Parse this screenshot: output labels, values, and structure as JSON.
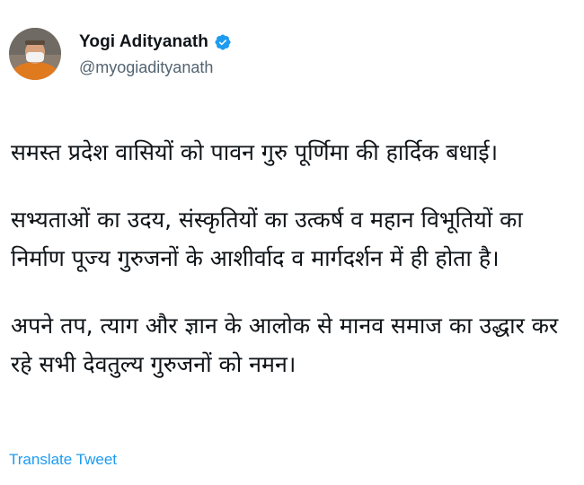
{
  "author": {
    "name": "Yogi Adityanath",
    "handle": "@myogiadityanath",
    "verified_icon": "verified-badge-icon",
    "avatar_icon": "profile-avatar"
  },
  "tweet": {
    "paragraphs": [
      "समस्त प्रदेश वासियों को पावन गुरु पूर्णिमा की हार्दिक बधाई।",
      "सभ्यताओं का उदय, संस्कृतियों का उत्कर्ष व महान विभूतियों का निर्माण पूज्य गुरुजनों के आशीर्वाद व मार्गदर्शन में ही होता है।",
      "अपने तप, त्याग और ज्ञान के आलोक से मानव समाज का उद्धार कर रहे सभी देवतुल्य गुरुजनों को नमन।"
    ],
    "translate_label": "Translate Tweet"
  },
  "colors": {
    "text": "#0f1419",
    "secondary": "#536471",
    "link": "#1d9bf0"
  }
}
